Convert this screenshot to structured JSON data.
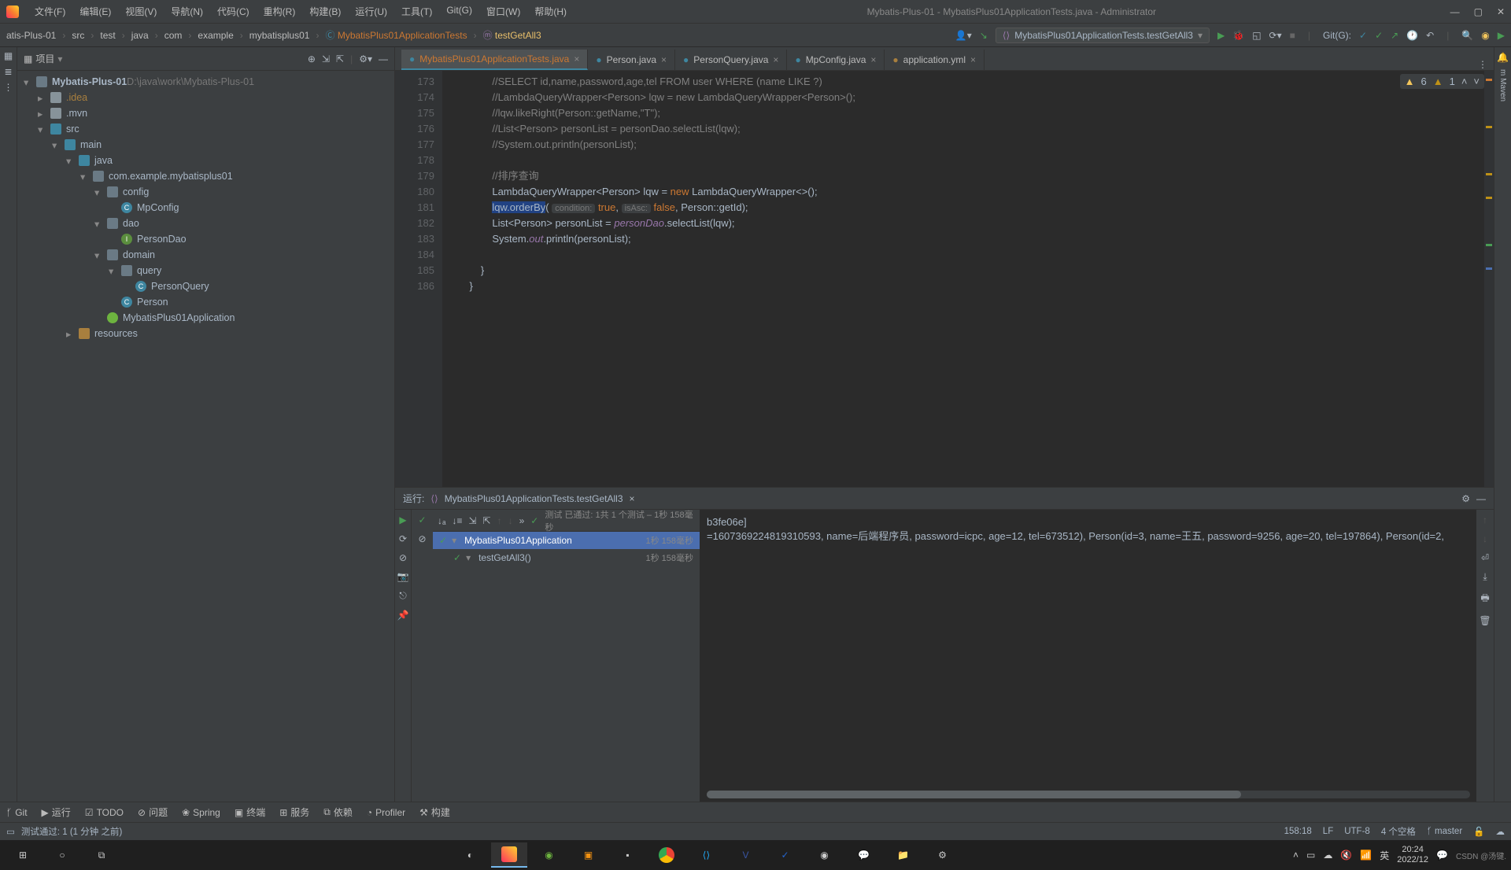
{
  "window": {
    "title": "Mybatis-Plus-01 - MybatisPlus01ApplicationTests.java - Administrator"
  },
  "menu": [
    "文件(F)",
    "编辑(E)",
    "视图(V)",
    "导航(N)",
    "代码(C)",
    "重构(R)",
    "构建(B)",
    "运行(U)",
    "工具(T)",
    "Git(G)",
    "窗口(W)",
    "帮助(H)"
  ],
  "breadcrumbs": [
    "atis-Plus-01",
    "src",
    "test",
    "java",
    "com",
    "example",
    "mybatisplus01",
    "MybatisPlus01ApplicationTests",
    "testGetAll3"
  ],
  "runConfig": "MybatisPlus01ApplicationTests.testGetAll3",
  "gitLabel": "Git(G):",
  "projectPanel": {
    "title": "项目",
    "rootName": "Mybatis-Plus-01",
    "rootPath": "D:\\java\\work\\Mybatis-Plus-01"
  },
  "tree": [
    {
      "indent": 0,
      "chev": "▾",
      "icon": "module",
      "label": "Mybatis-Plus-01",
      "suffix": " D:\\java\\work\\Mybatis-Plus-01",
      "bold": true
    },
    {
      "indent": 1,
      "chev": "▸",
      "icon": "folder",
      "label": ".idea",
      "muted": true
    },
    {
      "indent": 1,
      "chev": "▸",
      "icon": "folder",
      "label": ".mvn"
    },
    {
      "indent": 1,
      "chev": "▾",
      "icon": "folder-blue",
      "label": "src"
    },
    {
      "indent": 2,
      "chev": "▾",
      "icon": "folder-blue",
      "label": "main"
    },
    {
      "indent": 3,
      "chev": "▾",
      "icon": "folder-blue",
      "label": "java"
    },
    {
      "indent": 4,
      "chev": "▾",
      "icon": "pkg",
      "label": "com.example.mybatisplus01"
    },
    {
      "indent": 5,
      "chev": "▾",
      "icon": "pkg",
      "label": "config"
    },
    {
      "indent": 6,
      "chev": "",
      "icon": "class",
      "label": "MpConfig"
    },
    {
      "indent": 5,
      "chev": "▾",
      "icon": "pkg",
      "label": "dao"
    },
    {
      "indent": 6,
      "chev": "",
      "icon": "interface",
      "label": "PersonDao"
    },
    {
      "indent": 5,
      "chev": "▾",
      "icon": "pkg",
      "label": "domain"
    },
    {
      "indent": 6,
      "chev": "▾",
      "icon": "pkg",
      "label": "query"
    },
    {
      "indent": 7,
      "chev": "",
      "icon": "class",
      "label": "PersonQuery"
    },
    {
      "indent": 6,
      "chev": "",
      "icon": "class",
      "label": "Person"
    },
    {
      "indent": 5,
      "chev": "",
      "icon": "boot",
      "label": "MybatisPlus01Application"
    },
    {
      "indent": 3,
      "chev": "▸",
      "icon": "folder-res",
      "label": "resources"
    }
  ],
  "editorTabs": [
    {
      "label": "MybatisPlus01ApplicationTests.java",
      "active": true,
      "orange": true
    },
    {
      "label": "Person.java"
    },
    {
      "label": "PersonQuery.java"
    },
    {
      "label": "MpConfig.java"
    },
    {
      "label": "application.yml",
      "yml": true
    }
  ],
  "inspections": {
    "errors": 6,
    "warnings": 1
  },
  "code": {
    "startLine": 173,
    "lines": [
      {
        "n": 173,
        "html": "            <span class='cmt'>//SELECT id,name,password,age,tel FROM user WHERE (name LIKE ?)</span>"
      },
      {
        "n": 174,
        "html": "            <span class='cmt'>//LambdaQueryWrapper&lt;Person&gt; lqw = new LambdaQueryWrapper&lt;Person&gt;();</span>"
      },
      {
        "n": 175,
        "html": "            <span class='cmt'>//lqw.likeRight(Person::getName,\"T\");</span>"
      },
      {
        "n": 176,
        "html": "            <span class='cmt'>//List&lt;Person&gt; personList = personDao.selectList(lqw);</span>"
      },
      {
        "n": 177,
        "html": "            <span class='cmt'>//System.out.println(personList);</span>"
      },
      {
        "n": 178,
        "html": ""
      },
      {
        "n": 179,
        "html": "            <span class='cmt'>//排序查询</span>"
      },
      {
        "n": 180,
        "html": "            LambdaQueryWrapper&lt;Person&gt; lqw = <span class='kw'>new</span> LambdaQueryWrapper&lt;&gt;();"
      },
      {
        "n": 181,
        "html": "            <span class='hl-bg'>lqw.orderBy</span>( <span class='hint'>condition:</span> <span class='kw'>true</span>, <span class='hint'>isAsc:</span> <span class='kw'>false</span>, Person::getId);"
      },
      {
        "n": 182,
        "html": "            List&lt;Person&gt; personList = <span class='fld'>personDao</span>.selectList(lqw);"
      },
      {
        "n": 183,
        "html": "            System.<span class='fld'>out</span>.println(personList);"
      },
      {
        "n": 184,
        "html": ""
      },
      {
        "n": 185,
        "html": "        }"
      },
      {
        "n": 186,
        "html": "    }"
      }
    ]
  },
  "runPanel": {
    "label": "运行:",
    "config": "MybatisPlus01ApplicationTests.testGetAll3",
    "testSummary": "测试 已通过: 1共 1 个测试 – 1秒 158毫秒",
    "tree": [
      {
        "label": "MybatisPlus01Application",
        "dur": "1秒 158毫秒",
        "sel": true,
        "indent": 0
      },
      {
        "label": "testGetAll3()",
        "dur": "1秒 158毫秒",
        "indent": 1
      }
    ],
    "consoleLines": [
      "",
      "",
      "",
      "",
      "",
      "",
      "",
      "b3fe06e]",
      "=1607369224819310593, name=后端程序员, password=icpc, age=12, tel=673512), Person(id=3, name=王五, password=9256, age=20, tel=197864), Person(id=2, "
    ]
  },
  "bottomBar": [
    "Git",
    "运行",
    "TODO",
    "问题",
    "Spring",
    "终端",
    "服务",
    "依赖",
    "Profiler",
    "构建"
  ],
  "statusBar": {
    "left": "测试通过: 1 (1 分钟 之前)",
    "pos": "158:18",
    "eol": "LF",
    "enc": "UTF-8",
    "indent": "4 个空格",
    "branch": "master"
  },
  "taskbar": {
    "time": "20:24",
    "date": "2022/12",
    "watermark": "CSDN @汤键."
  }
}
